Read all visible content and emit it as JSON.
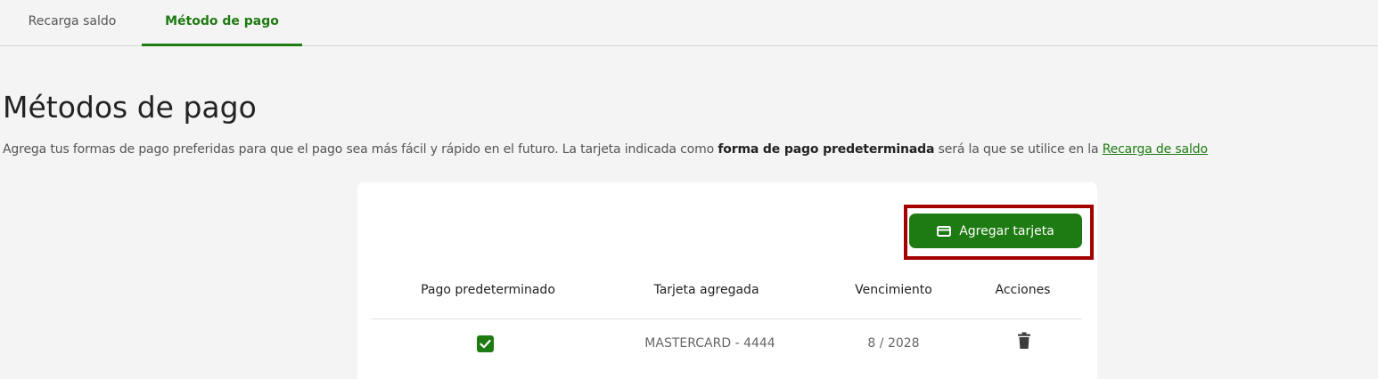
{
  "tabs": [
    {
      "label": "Recarga saldo",
      "active": false
    },
    {
      "label": "Método de pago",
      "active": true
    }
  ],
  "page": {
    "title": "Métodos de pago",
    "intro_before": "Agrega tus formas de pago preferidas para que el pago sea más fácil y rápido en el futuro. La tarjeta indicada como ",
    "intro_bold": "forma de pago predeterminada",
    "intro_after": " será la que se utilice en la ",
    "intro_link": "Recarga de saldo"
  },
  "actions": {
    "add_card_label": "Agregar tarjeta",
    "add_card_icon": "credit-card-icon"
  },
  "table": {
    "headers": [
      "Pago predeterminado",
      "Tarjeta agregada",
      "Vencimiento",
      "Acciones"
    ],
    "rows": [
      {
        "default": true,
        "card": "MASTERCARD - 4444",
        "expiry": "8 / 2028",
        "action_icon": "trash-icon"
      }
    ]
  },
  "colors": {
    "accent": "#1e7a12",
    "highlight": "#a40000",
    "page_background": "#f4f4f4",
    "card_background": "#ffffff"
  }
}
